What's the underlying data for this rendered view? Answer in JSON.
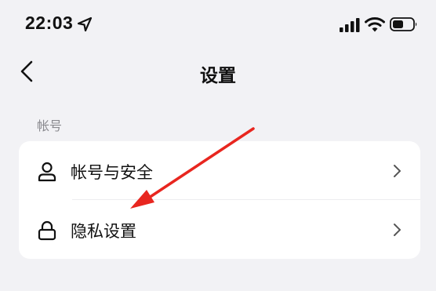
{
  "status_bar": {
    "time": "22:03",
    "icons": [
      "location-arrow-icon",
      "cellular-signal-icon",
      "wifi-icon",
      "battery-icon"
    ]
  },
  "nav": {
    "title": "设置",
    "back_icon": "chevron-left-icon"
  },
  "sections": [
    {
      "header": "帐号",
      "items": [
        {
          "label": "帐号与安全",
          "icon": "user-icon",
          "trailing_icon": "chevron-right-icon"
        },
        {
          "label": "隐私设置",
          "icon": "lock-icon",
          "trailing_icon": "chevron-right-icon"
        }
      ]
    }
  ],
  "colors": {
    "background": "#f2f2f5",
    "card": "#ffffff",
    "section_header": "#8a8a8f",
    "annotation_arrow": "#e8261f"
  }
}
